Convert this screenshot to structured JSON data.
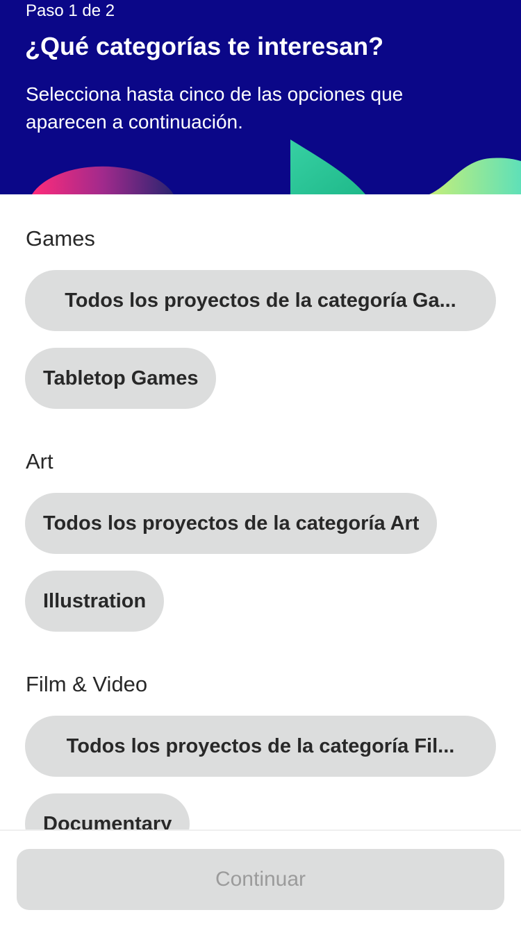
{
  "header": {
    "step": "Paso 1 de 2",
    "title": "¿Qué categorías te interesan?",
    "subtitle": "Selecciona hasta cinco de las opciones que aparecen a continuación."
  },
  "sections": [
    {
      "title": "Games",
      "options": [
        "Todos los proyectos de la categoría Ga...",
        "Tabletop Games"
      ]
    },
    {
      "title": "Art",
      "options": [
        "Todos los proyectos de la categoría Art",
        "Illustration"
      ]
    },
    {
      "title": "Film & Video",
      "options": [
        "Todos los proyectos de la categoría Fil...",
        "Documentary"
      ]
    }
  ],
  "footer": {
    "continue_label": "Continuar"
  },
  "colors": {
    "header_background": "#0b0788",
    "chip_background": "#dcdddd",
    "button_disabled_background": "#dcdddd",
    "button_disabled_text": "#9b9b9b"
  }
}
